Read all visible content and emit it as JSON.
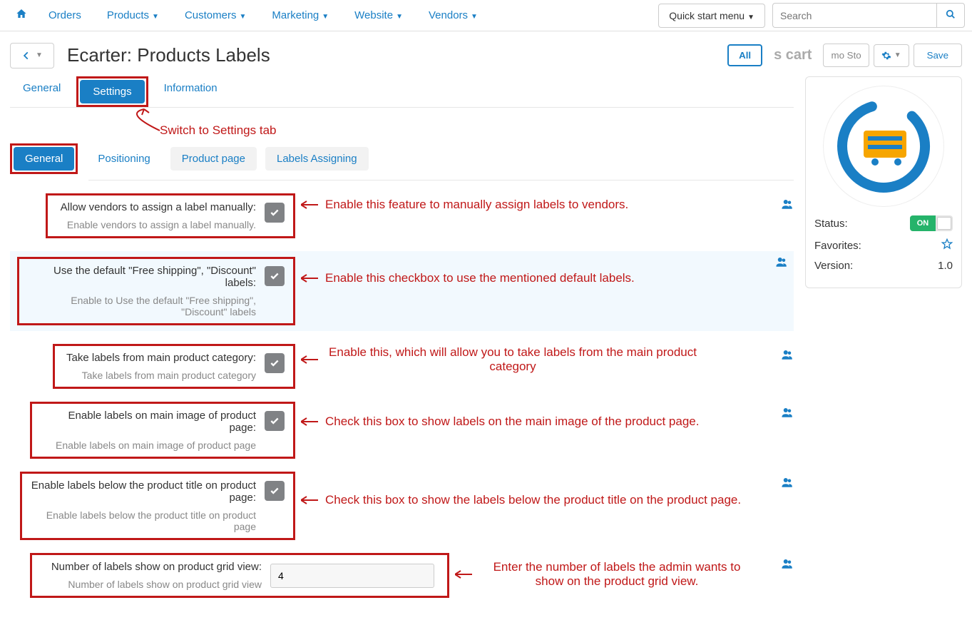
{
  "nav": {
    "items": [
      "Orders",
      "Products",
      "Customers",
      "Marketing",
      "Website",
      "Vendors"
    ],
    "quick_start": "Quick start menu",
    "search_placeholder": "Search"
  },
  "header": {
    "title": "Ecarter: Products Labels",
    "all": "All",
    "cart_text": "s cart",
    "demo_text": "mo Sto",
    "save": "Save"
  },
  "tabs": {
    "items": [
      "General",
      "Settings",
      "Information"
    ],
    "active": 1
  },
  "subtabs": {
    "items": [
      "General",
      "Positioning",
      "Product page",
      "Labels Assigning"
    ],
    "active": 0
  },
  "annot": {
    "switch_settings": "Switch to Settings tab",
    "r0": "Enable this feature to manually assign labels to vendors.",
    "r1": "Enable this checkbox to use the mentioned default labels.",
    "r2": "Enable this, which will allow you to take labels from the main product category",
    "r3": "Check this box to show labels on the main image of the product page.",
    "r4": "Check this box to show the labels below the product title on the product page.",
    "r5": "Enter the number of labels the admin wants to show on the product grid view."
  },
  "fields": {
    "r0": {
      "label": "Allow vendors to assign a label manually:",
      "help": "Enable vendors to assign a label manually.",
      "checked": true
    },
    "r1": {
      "label": "Use the default \"Free shipping\", \"Discount\" labels:",
      "help": "Enable to Use the default \"Free shipping\", \"Discount\" labels",
      "checked": true
    },
    "r2": {
      "label": "Take labels from main product category:",
      "help": "Take labels from main product category",
      "checked": true
    },
    "r3": {
      "label": "Enable labels on main image of product page:",
      "help": "Enable labels on main image of product page",
      "checked": true
    },
    "r4": {
      "label": "Enable labels below the product title on product page:",
      "help": "Enable labels below the product title on product page",
      "checked": true
    },
    "r5": {
      "label": "Number of labels show on product grid view:",
      "help": "Number of labels show on product grid view",
      "value": "4"
    }
  },
  "sidebar": {
    "status_label": "Status:",
    "status_value": "ON",
    "fav_label": "Favorites:",
    "version_label": "Version:",
    "version_value": "1.0"
  }
}
